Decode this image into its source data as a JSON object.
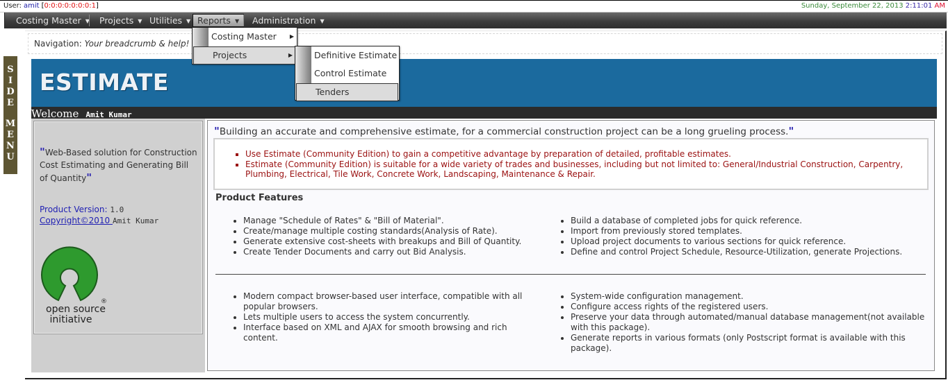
{
  "topbar": {
    "user_label": "User:",
    "user_name": "amit",
    "ip_open": "[",
    "ip": "0:0:0:0:0:0:0:1",
    "ip_close": "]",
    "date": "Sunday, September 22, 2013",
    "time": "2:11:01",
    "ampm": "AM"
  },
  "menubar": {
    "items": [
      {
        "label": "Costing Master",
        "caret": "▼"
      },
      {
        "label": "Projects",
        "caret": "▼"
      },
      {
        "label": "Utilities",
        "caret": "▼"
      },
      {
        "label": "Reports",
        "caret": "▼",
        "active": true
      },
      {
        "label": "Administration",
        "caret": "▼"
      }
    ]
  },
  "reports_menu": {
    "items": [
      {
        "label": "Costing Master",
        "arrow": "▶"
      },
      {
        "label": "Projects",
        "arrow": "▶",
        "highlighted": true
      }
    ]
  },
  "projects_submenu": {
    "items": [
      {
        "label": "Definitive Estimate"
      },
      {
        "label": "Control Estimate"
      },
      {
        "label": "Tenders",
        "highlighted": true
      }
    ]
  },
  "side_menu": {
    "letters": [
      "S",
      "I",
      "D",
      "E",
      "M",
      "E",
      "N",
      "U"
    ]
  },
  "navigation": {
    "label": "Navigation:",
    "text": "Your breadcrumb & help!"
  },
  "banner": {
    "title": "ESTIMATE",
    "welcome": "Welcome",
    "user": "Amit Kumar"
  },
  "left_panel": {
    "quote_open": "\"",
    "tagline": "Web-Based solution for Construction Cost Estimating and Generating Bill of Quantity",
    "quote_close": "\"",
    "version_label": "Product Version:",
    "version": "1.0",
    "copyright_link": "Copyright©2010 ",
    "author": "Amit Kumar",
    "logo_text_1": "open source",
    "logo_text_2": "initiative",
    "logo_mark": "®"
  },
  "main": {
    "quote_open": "\"",
    "quote": "Building an accurate and comprehensive estimate, for a commercial construction project can be a long grueling process.",
    "quote_close": "\"",
    "highlights": [
      "Use Estimate (Community Edition) to gain a competitive advantage by preparation of detailed, profitable estimates.",
      "Estimate (Community Edition) is suitable for a wide variety of trades and businesses, including but not limited to: General/Industrial Construction, Carpentry, Plumbing, Electrical, Tile Work, Concrete Work, Landscaping, Maintenance & Repair."
    ],
    "features_title": "Product Features",
    "features_1": [
      "Manage \"Schedule of Rates\" & \"Bill of Material\".",
      "Create/manage multiple costing standards(Analysis of Rate).",
      "Generate extensive cost-sheets with breakups and Bill of Quantity.",
      "Create Tender Documents and carry out Bid Analysis."
    ],
    "features_2": [
      "Build a database of completed jobs for quick reference.",
      "Import from previously stored templates.",
      "Upload project documents to various sections for quick reference.",
      "Define and control Project Schedule, Resource-Utilization, generate Projections."
    ],
    "features_3": [
      "Modern compact browser-based user interface, compatible with all popular browsers.",
      "Lets multiple users to access the system concurrently.",
      "Interface based on XML and AJAX for smooth browsing and rich content."
    ],
    "features_4": [
      "System-wide configuration management.",
      "Configure access rights of the registered users.",
      "Preserve your data through automated/manual database management(not available with this package).",
      "Generate reports in various formats (only Postscript format is available with this package)."
    ]
  },
  "colors": {
    "banner": "#1b6a9e",
    "menubar": "#3c3c3c",
    "side_tab": "#5e5633",
    "highlight_text": "#9a1010",
    "link": "#1f1fb3",
    "osi_green": "#2e9a2e"
  }
}
